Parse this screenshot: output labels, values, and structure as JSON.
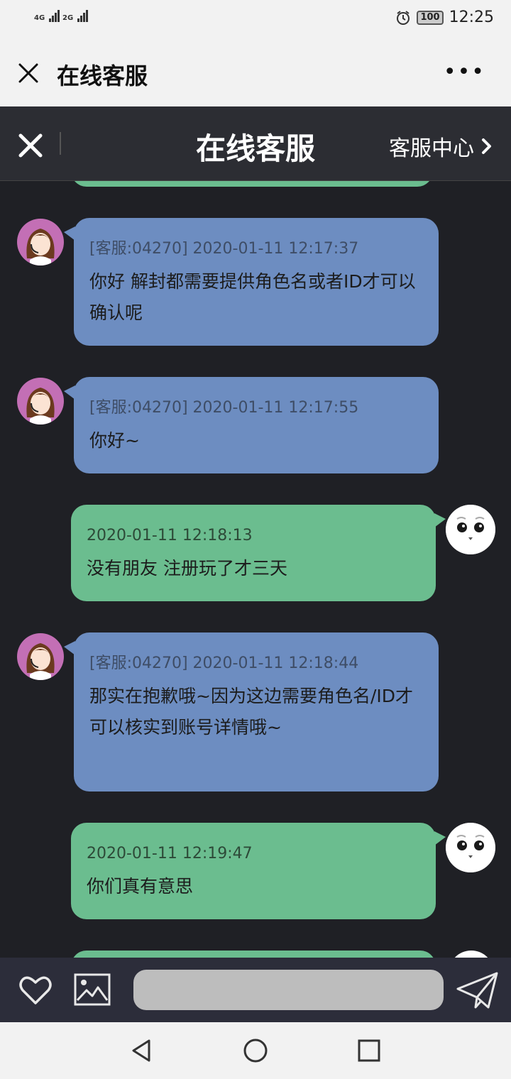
{
  "status_bar": {
    "signal_1": "4G",
    "signal_2": "2G",
    "battery": "100",
    "time": "12:25",
    "icons": [
      "alarm-icon",
      "battery-icon"
    ]
  },
  "wechat_bar": {
    "title": "在线客服",
    "icons": [
      "close-icon",
      "more-icon"
    ]
  },
  "header": {
    "title": "在线客服",
    "service_center": "客服中心",
    "icons": [
      "close-icon",
      "chevron-right-icon"
    ]
  },
  "messages": [
    {
      "sender": "agent",
      "meta": "[客服:04270] 2020-01-11 12:17:37",
      "text": "你好 解封都需要提供角色名或者ID才可以确认呢"
    },
    {
      "sender": "agent",
      "meta": "[客服:04270] 2020-01-11 12:17:55",
      "text": "你好~"
    },
    {
      "sender": "user",
      "meta": "2020-01-11 12:18:13",
      "text": "没有朋友 注册玩了才三天"
    },
    {
      "sender": "agent",
      "meta": "[客服:04270] 2020-01-11 12:18:44",
      "text": "那实在抱歉哦~因为这边需要角色名/ID才可以核实到账号详情哦~"
    },
    {
      "sender": "user",
      "meta": "2020-01-11 12:19:47",
      "text": "你们真有意思"
    }
  ],
  "input_bar": {
    "placeholder": "",
    "icons": [
      "heart-icon",
      "image-icon",
      "send-icon"
    ]
  },
  "nav_bar": {
    "icons": [
      "back-icon",
      "home-icon",
      "recents-icon"
    ]
  },
  "colors": {
    "background": "#1f2025",
    "header": "#2c2d33",
    "agent_bubble": "#6d8dc1",
    "user_bubble": "#6bbd8f",
    "input_bar": "#2c2d3a"
  }
}
